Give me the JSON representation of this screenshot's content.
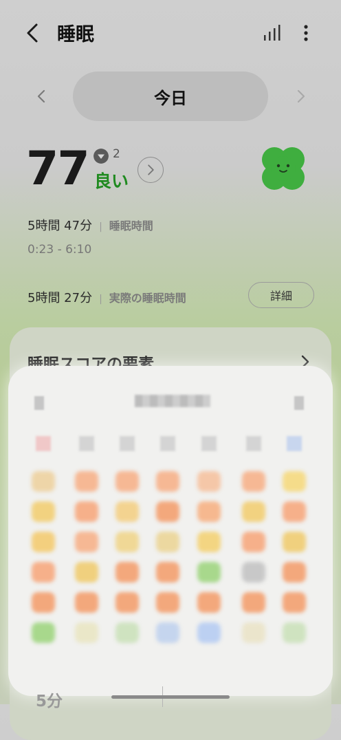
{
  "header": {
    "title": "睡眠",
    "back_icon": "chevron-left-icon",
    "trend_icon": "bar-chart-icon",
    "more_icon": "more-vert-icon"
  },
  "date_nav": {
    "current": "今日"
  },
  "score": {
    "value": "77",
    "delta": "2",
    "rating": "良い",
    "rating_color": "#1f8a1f"
  },
  "sleep": {
    "duration": "5時間 47分",
    "duration_label": "睡眠時間",
    "time_range": "0:23 - 6:10",
    "actual_duration": "5時間 27分",
    "actual_label": "実際の睡眠時間",
    "detail_button": "詳細"
  },
  "factors": {
    "title": "睡眠スコアの要素"
  },
  "bottom": {
    "partial_value": "5分"
  },
  "overlay_grid": [
    [
      "#eed5a8",
      "#f6b894",
      "#f6b894",
      "#f6b894",
      "#f5c7a8",
      "#f6b894",
      "#f5dc8a"
    ],
    [
      "#f2d280",
      "#f6b08a",
      "#f3d390",
      "#f3a87c",
      "#f6b88f",
      "#f2d280",
      "#f6b08a"
    ],
    [
      "#f3cf7e",
      "#f6b894",
      "#f0d896",
      "#ecd8a0",
      "#f3d582",
      "#f6b08a",
      "#f0d07e"
    ],
    [
      "#f6b08a",
      "#f0d07e",
      "#f3a87c",
      "#f3a87c",
      "#a8d88c",
      "#c8c8c8",
      "#f3a87c"
    ],
    [
      "#f3a87c",
      "#f3a87c",
      "#f3a87c",
      "#f3a87c",
      "#f3a87c",
      "#f3a87c",
      "#f3a87c"
    ],
    [
      "#a8d88c",
      "#eae7c8",
      "#cfe3c0",
      "#c5d5ee",
      "#bcd0f2",
      "#ebe5cc",
      "#cfe3c0"
    ]
  ],
  "overlay_heads": [
    "#f0c8c8",
    "#d4d4d4",
    "#d4d4d4",
    "#d4d4d4",
    "#d4d4d4",
    "#d4d4d4",
    "#c8d6ee"
  ]
}
